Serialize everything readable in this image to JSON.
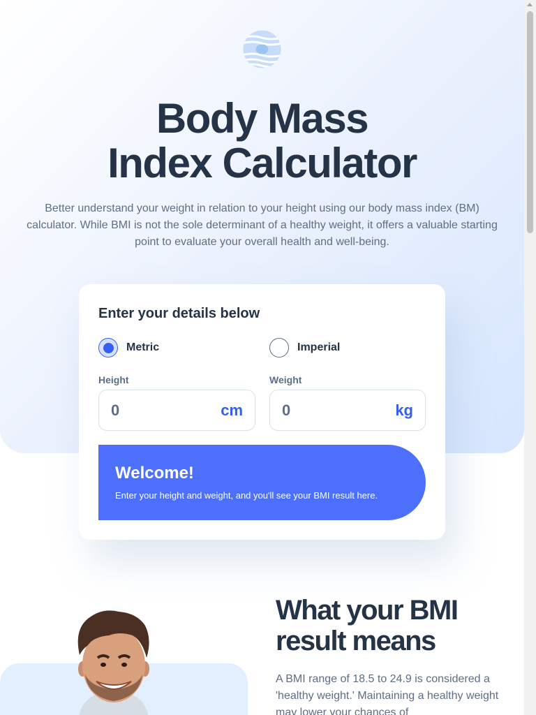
{
  "hero": {
    "title_line1": "Body Mass",
    "title_line2": "Index Calculator",
    "intro": "Better understand your weight in relation to your height using our body mass index (BM) calculator. While BMI is not the sole determinant of a healthy weight, it offers a valuable starting point to evaluate your overall health and well-being."
  },
  "form": {
    "heading": "Enter your details below",
    "units": [
      {
        "label": "Metric",
        "selected": true
      },
      {
        "label": "Imperial",
        "selected": false
      }
    ],
    "height": {
      "label": "Height",
      "value": "0",
      "unit": "cm"
    },
    "weight": {
      "label": "Weight",
      "value": "0",
      "unit": "kg"
    },
    "result": {
      "title": "Welcome!",
      "text": "Enter your height and weight, and you'll see your BMI result here."
    }
  },
  "meaning": {
    "title": "What your BMI result means",
    "text": "A BMI range of 18.5 to 24.9 is considered a 'healthy weight.' Maintaining a healthy weight may lower your chances of"
  },
  "colors": {
    "accent": "#345ff6",
    "result_bg": "#4d70fc",
    "heading": "#253347",
    "body_text": "#5e6e85"
  },
  "icons": {
    "logo": "bmi-logo-icon",
    "selected_radio": "radio-checked-icon",
    "unselected_radio": "radio-unchecked-icon"
  }
}
